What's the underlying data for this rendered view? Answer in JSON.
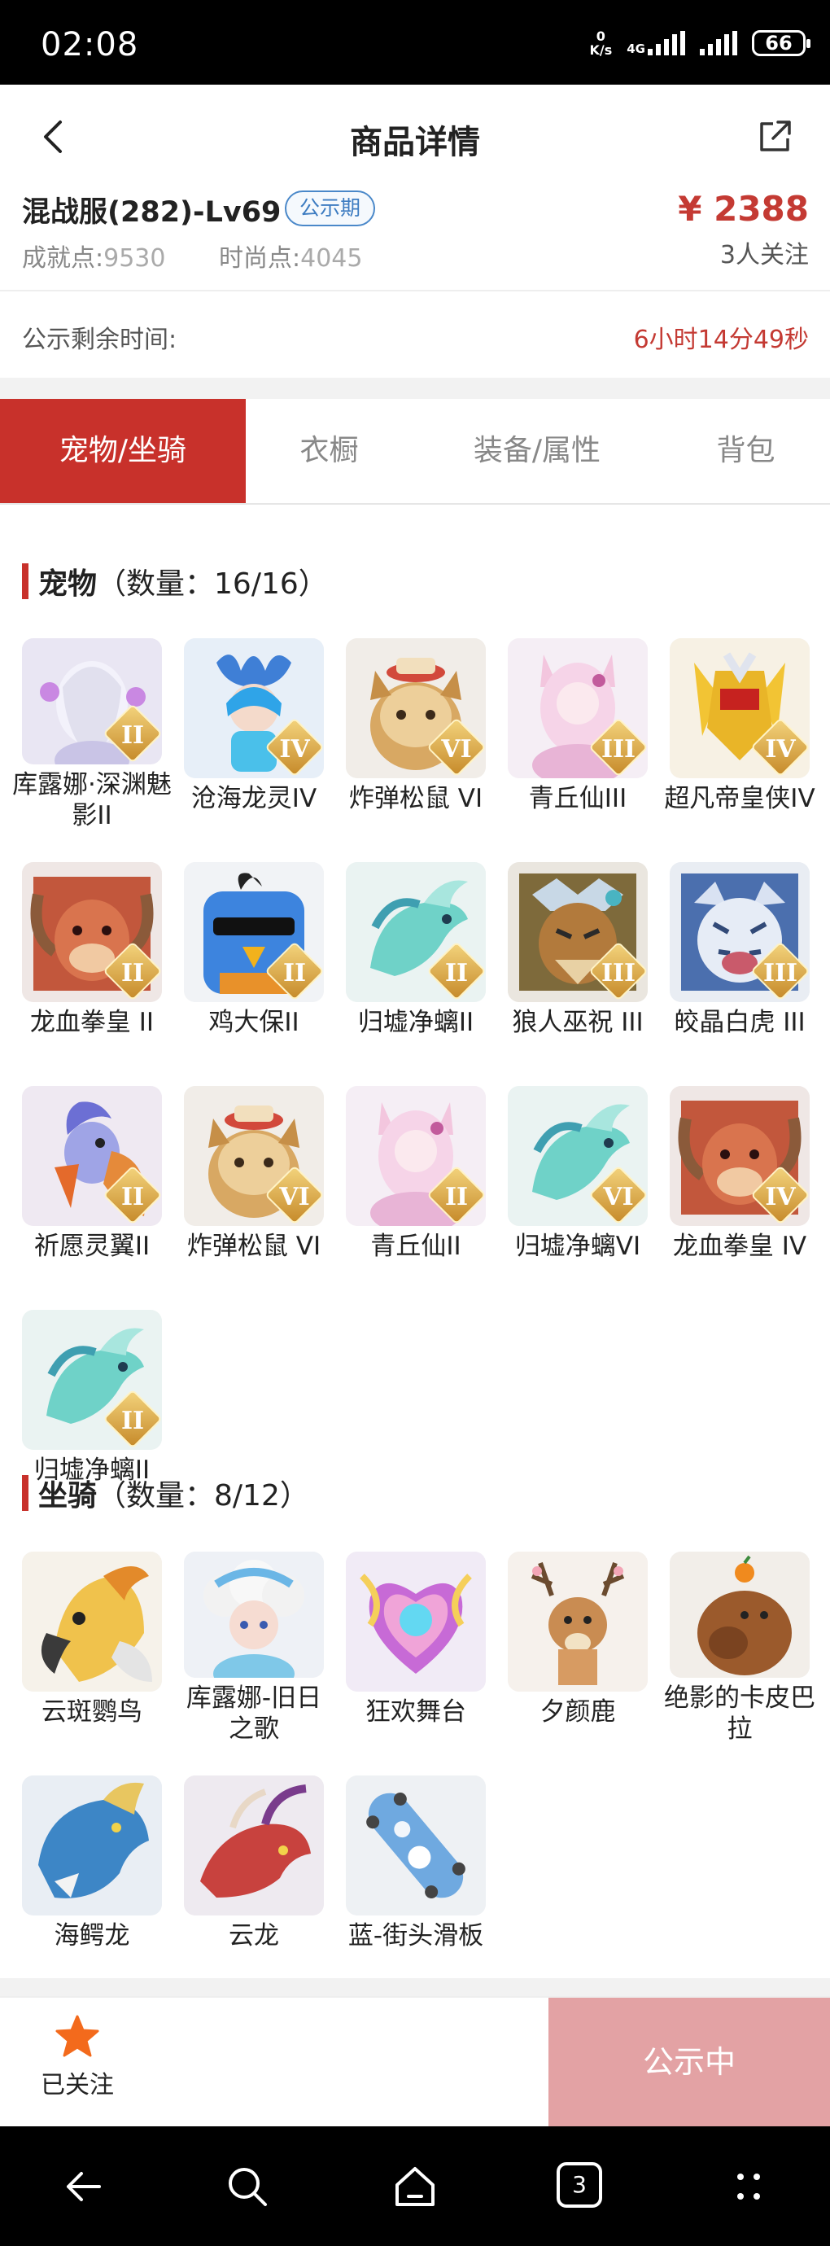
{
  "status_bar": {
    "time": "02:08",
    "net_speed_value": "0",
    "net_speed_unit": "K/s",
    "network": "4G",
    "battery": "66"
  },
  "header": {
    "title": "商品详情",
    "back_icon": "chevron-left-icon",
    "share_icon": "share-icon"
  },
  "product": {
    "name": "混战服(282)-Lv69",
    "badge": "公示期",
    "achievement_label": "成就点:",
    "achievement_value": "9530",
    "fashion_label": "时尚点:",
    "fashion_value": "4045",
    "price": "¥ 2388",
    "followers": "3人关注"
  },
  "countdown": {
    "label": "公示剩余时间:",
    "value": "6小时14分49秒"
  },
  "tabs": [
    {
      "label": "宠物/坐骑",
      "active": true
    },
    {
      "label": "衣橱",
      "active": false
    },
    {
      "label": "装备/属性",
      "active": false
    },
    {
      "label": "背包",
      "active": false
    }
  ],
  "pets": {
    "title": "宠物",
    "count": "（数量：16/16）",
    "items": [
      {
        "name": "库露娜·深渊魅影II",
        "rank": "II",
        "art": "maiden-white"
      },
      {
        "name": "沧海龙灵IV",
        "rank": "IV",
        "art": "sea-boy"
      },
      {
        "name": "炸弹松鼠 VI",
        "rank": "VI",
        "art": "squirrel"
      },
      {
        "name": "青丘仙III",
        "rank": "III",
        "art": "fox-maiden"
      },
      {
        "name": "超凡帝皇侠IV",
        "rank": "IV",
        "art": "gold-mecha"
      },
      {
        "name": "龙血拳皇 II",
        "rank": "II",
        "art": "red-beast"
      },
      {
        "name": "鸡大保II",
        "rank": "II",
        "art": "blue-bird"
      },
      {
        "name": "归墟净螭II",
        "rank": "II",
        "art": "teal-dragon"
      },
      {
        "name": "狼人巫祝 III",
        "rank": "III",
        "art": "wolf-shaman"
      },
      {
        "name": "皎晶白虎 III",
        "rank": "III",
        "art": "white-tiger"
      },
      {
        "name": "祈愿灵翼II",
        "rank": "II",
        "art": "phoenix-bird"
      },
      {
        "name": "炸弹松鼠 VI",
        "rank": "VI",
        "art": "squirrel"
      },
      {
        "name": "青丘仙II",
        "rank": "II",
        "art": "fox-maiden"
      },
      {
        "name": "归墟净螭VI",
        "rank": "VI",
        "art": "teal-dragon"
      },
      {
        "name": "龙血拳皇 IV",
        "rank": "IV",
        "art": "red-beast"
      },
      {
        "name": "归墟净螭II",
        "rank": "II",
        "art": "teal-dragon"
      }
    ]
  },
  "mounts": {
    "title": "坐骑",
    "count": "（数量：8/12）",
    "items": [
      {
        "name": "云斑鹦鸟",
        "art": "parrot"
      },
      {
        "name": "库露娜-旧日之歌",
        "art": "cloud-girl"
      },
      {
        "name": "狂欢舞台",
        "art": "heart-stage"
      },
      {
        "name": "夕颜鹿",
        "art": "deer"
      },
      {
        "name": "绝影的卡皮巴拉",
        "art": "capybara"
      },
      {
        "name": "海鳄龙",
        "art": "blue-dragon"
      },
      {
        "name": "云龙",
        "art": "red-dragon"
      },
      {
        "name": "蓝-街头滑板",
        "art": "skateboard"
      }
    ]
  },
  "bottom": {
    "follow_label": "已关注",
    "follow_icon": "star-icon",
    "action_label": "公示中"
  },
  "nav": {
    "recent_count": "3"
  }
}
